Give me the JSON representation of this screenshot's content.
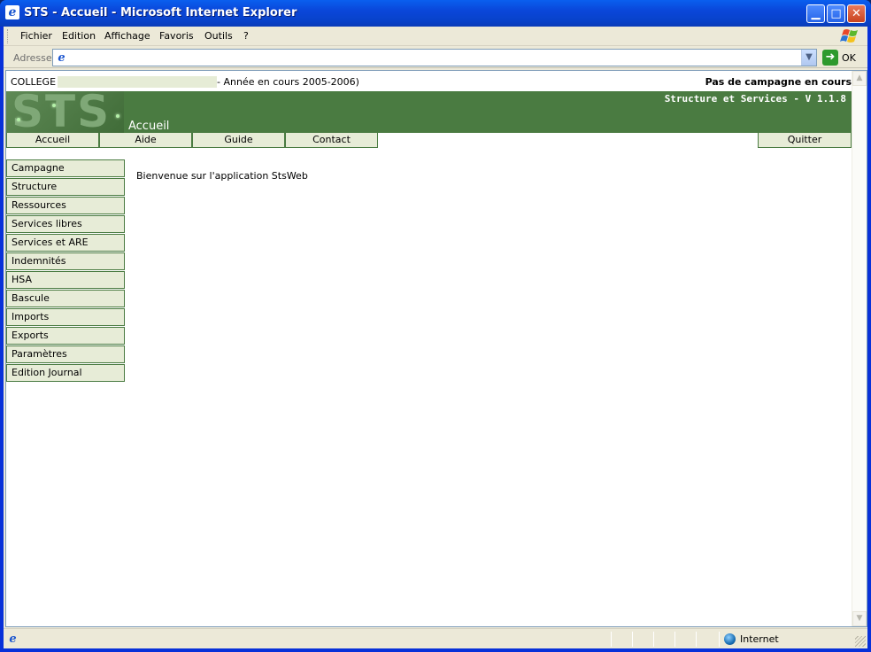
{
  "window": {
    "title": "STS - Accueil - Microsoft Internet Explorer",
    "min_glyph": "▁",
    "max_glyph": "□",
    "close_glyph": "✕"
  },
  "menubar": {
    "items": [
      "Fichier",
      "Edition",
      "Affichage",
      "Favoris",
      "Outils",
      "?"
    ]
  },
  "addressbar": {
    "label": "Adresse",
    "url": "",
    "go_label": "OK"
  },
  "page": {
    "college_label": "COLLEGE",
    "year_text": "- Année en cours 2005-2006)",
    "campaign_status": "Pas de campagne en cours",
    "logo_text": "STS",
    "banner_subtitle": "Structure et Services - V 1.1.8",
    "banner_page": "Accueil",
    "top_nav": [
      "Accueil",
      "Aide",
      "Guide",
      "Contact"
    ],
    "quit_label": "Quitter",
    "side_nav": [
      "Campagne",
      "Structure",
      "Ressources",
      "Services libres",
      "Services et ARE",
      "Indemnités",
      "HSA",
      "Bascule",
      "Imports",
      "Exports",
      "Paramètres",
      "Edition Journal"
    ],
    "welcome_text": "Bienvenue sur l'application StsWeb"
  },
  "statusbar": {
    "text": "",
    "zone_label": "Internet"
  },
  "colors": {
    "banner_green": "#4a7b41",
    "nav_fill": "#e7ecd7",
    "titlebar_blue": "#0a46d9"
  }
}
